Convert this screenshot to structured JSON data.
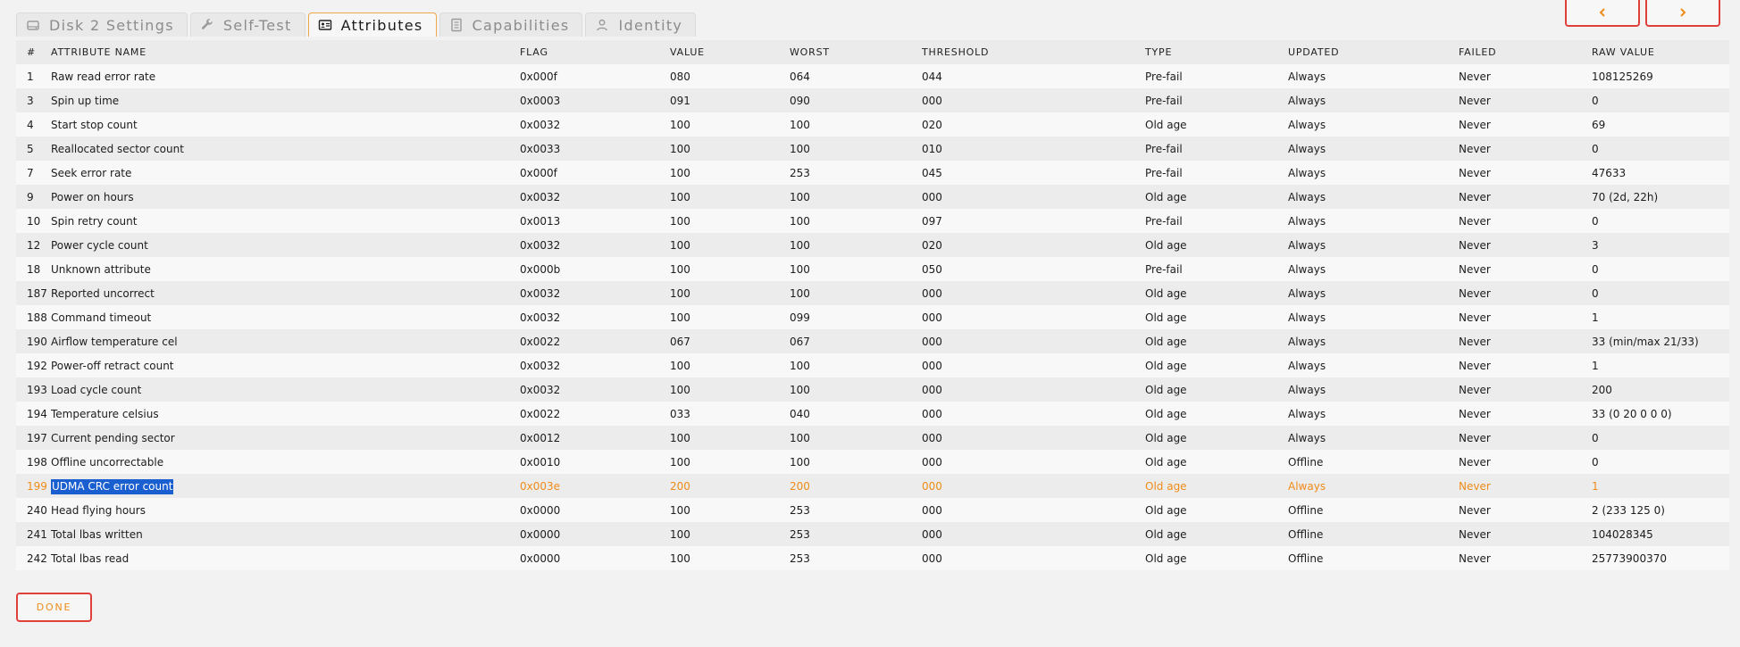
{
  "tabs": [
    {
      "label": "Disk 2 Settings",
      "icon": "disk-icon",
      "active": false
    },
    {
      "label": "Self-Test",
      "icon": "wrench-icon",
      "active": false
    },
    {
      "label": "Attributes",
      "icon": "id-card-icon",
      "active": true
    },
    {
      "label": "Capabilities",
      "icon": "document-icon",
      "active": false
    },
    {
      "label": "Identity",
      "icon": "user-icon",
      "active": false
    }
  ],
  "nav": {
    "prev_icon": "chevron-left-icon",
    "next_icon": "chevron-right-icon"
  },
  "colors": {
    "accent": "#ef8c1a",
    "border_accent": "#e0403a",
    "selection": "#1a5fcf"
  },
  "table": {
    "columns": [
      "#",
      "ATTRIBUTE NAME",
      "FLAG",
      "VALUE",
      "WORST",
      "THRESHOLD",
      "TYPE",
      "UPDATED",
      "FAILED",
      "RAW VALUE"
    ],
    "rows": [
      [
        "1",
        "Raw read error rate",
        "0x000f",
        "080",
        "064",
        "044",
        "Pre-fail",
        "Always",
        "Never",
        "108125269"
      ],
      [
        "3",
        "Spin up time",
        "0x0003",
        "091",
        "090",
        "000",
        "Pre-fail",
        "Always",
        "Never",
        "0"
      ],
      [
        "4",
        "Start stop count",
        "0x0032",
        "100",
        "100",
        "020",
        "Old age",
        "Always",
        "Never",
        "69"
      ],
      [
        "5",
        "Reallocated sector count",
        "0x0033",
        "100",
        "100",
        "010",
        "Pre-fail",
        "Always",
        "Never",
        "0"
      ],
      [
        "7",
        "Seek error rate",
        "0x000f",
        "100",
        "253",
        "045",
        "Pre-fail",
        "Always",
        "Never",
        "47633"
      ],
      [
        "9",
        "Power on hours",
        "0x0032",
        "100",
        "100",
        "000",
        "Old age",
        "Always",
        "Never",
        "70 (2d, 22h)"
      ],
      [
        "10",
        "Spin retry count",
        "0x0013",
        "100",
        "100",
        "097",
        "Pre-fail",
        "Always",
        "Never",
        "0"
      ],
      [
        "12",
        "Power cycle count",
        "0x0032",
        "100",
        "100",
        "020",
        "Old age",
        "Always",
        "Never",
        "3"
      ],
      [
        "18",
        "Unknown attribute",
        "0x000b",
        "100",
        "100",
        "050",
        "Pre-fail",
        "Always",
        "Never",
        "0"
      ],
      [
        "187",
        "Reported uncorrect",
        "0x0032",
        "100",
        "100",
        "000",
        "Old age",
        "Always",
        "Never",
        "0"
      ],
      [
        "188",
        "Command timeout",
        "0x0032",
        "100",
        "099",
        "000",
        "Old age",
        "Always",
        "Never",
        "1"
      ],
      [
        "190",
        "Airflow temperature cel",
        "0x0022",
        "067",
        "067",
        "000",
        "Old age",
        "Always",
        "Never",
        "33 (min/max 21/33)"
      ],
      [
        "192",
        "Power-off retract count",
        "0x0032",
        "100",
        "100",
        "000",
        "Old age",
        "Always",
        "Never",
        "1"
      ],
      [
        "193",
        "Load cycle count",
        "0x0032",
        "100",
        "100",
        "000",
        "Old age",
        "Always",
        "Never",
        "200"
      ],
      [
        "194",
        "Temperature celsius",
        "0x0022",
        "033",
        "040",
        "000",
        "Old age",
        "Always",
        "Never",
        "33 (0 20 0 0 0)"
      ],
      [
        "197",
        "Current pending sector",
        "0x0012",
        "100",
        "100",
        "000",
        "Old age",
        "Always",
        "Never",
        "0"
      ],
      [
        "198",
        "Offline uncorrectable",
        "0x0010",
        "100",
        "100",
        "000",
        "Old age",
        "Offline",
        "Never",
        "0"
      ],
      [
        "199",
        "UDMA CRC error count",
        "0x003e",
        "200",
        "200",
        "000",
        "Old age",
        "Always",
        "Never",
        "1"
      ],
      [
        "240",
        "Head flying hours",
        "0x0000",
        "100",
        "253",
        "000",
        "Old age",
        "Offline",
        "Never",
        "2 (233 125 0)"
      ],
      [
        "241",
        "Total lbas written",
        "0x0000",
        "100",
        "253",
        "000",
        "Old age",
        "Offline",
        "Never",
        "104028345"
      ],
      [
        "242",
        "Total lbas read",
        "0x0000",
        "100",
        "253",
        "000",
        "Old age",
        "Offline",
        "Never",
        "25773900370"
      ]
    ],
    "warning_row": 17,
    "selected_cell": [
      17,
      1
    ]
  },
  "footer": {
    "done_label": "DONE"
  }
}
